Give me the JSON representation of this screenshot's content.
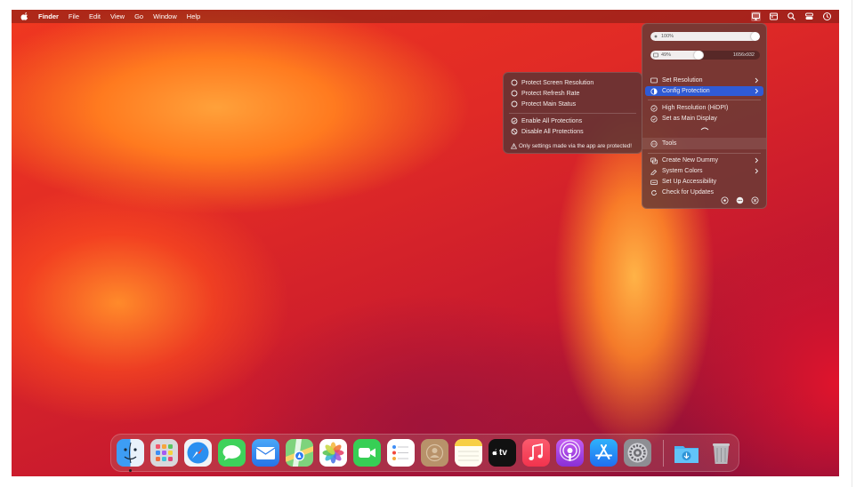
{
  "menubar": {
    "app_name": "Finder",
    "items": [
      "File",
      "Edit",
      "View",
      "Go",
      "Window",
      "Help"
    ],
    "status_icons": [
      "display-icon",
      "calendar-icon",
      "search-icon",
      "control-center-icon",
      "clock-icon"
    ]
  },
  "main_menu": {
    "brightness_label": "100%",
    "brightness_value": 1.0,
    "scale_label": "49%",
    "scale_value": 0.49,
    "resolution_label": "1656x932",
    "items": {
      "set_resolution": "Set Resolution",
      "config_protection": "Config Protection",
      "high_resolution": "High Resolution (HiDPI)",
      "set_main_display": "Set as Main Display",
      "tools": "Tools",
      "create_new_dummy": "Create New Dummy",
      "system_colors": "System Colors",
      "set_up_accessibility": "Set Up Accessibility",
      "check_for_updates": "Check for Updates"
    },
    "active_color": "#2f5bd6"
  },
  "protection_menu": {
    "protect_screen_resolution": "Protect Screen Resolution",
    "protect_refresh_rate": "Protect Refresh Rate",
    "protect_main_status": "Protect Main Status",
    "enable_all": "Enable All Protections",
    "disable_all": "Disable All Protections",
    "note": "Only settings made via the app are protected!"
  },
  "dock": {
    "apps": [
      {
        "name": "Finder",
        "icon": "finder-icon"
      },
      {
        "name": "Launchpad",
        "icon": "launchpad-icon"
      },
      {
        "name": "Safari",
        "icon": "safari-icon"
      },
      {
        "name": "Messages",
        "icon": "messages-icon"
      },
      {
        "name": "Mail",
        "icon": "mail-icon"
      },
      {
        "name": "Maps",
        "icon": "maps-icon"
      },
      {
        "name": "Photos",
        "icon": "photos-icon"
      },
      {
        "name": "FaceTime",
        "icon": "facetime-icon"
      },
      {
        "name": "Reminders",
        "icon": "reminders-icon"
      },
      {
        "name": "Contacts",
        "icon": "contacts-icon"
      },
      {
        "name": "Notes",
        "icon": "notes-icon"
      },
      {
        "name": "TV",
        "icon": "apple-tv-icon"
      },
      {
        "name": "Music",
        "icon": "music-icon"
      },
      {
        "name": "Podcasts",
        "icon": "podcasts-icon"
      },
      {
        "name": "App Store",
        "icon": "app-store-icon"
      },
      {
        "name": "System Settings",
        "icon": "system-settings-icon"
      }
    ],
    "tv_label": "tv",
    "trailing": [
      "downloads-folder-icon",
      "trash-icon"
    ]
  }
}
